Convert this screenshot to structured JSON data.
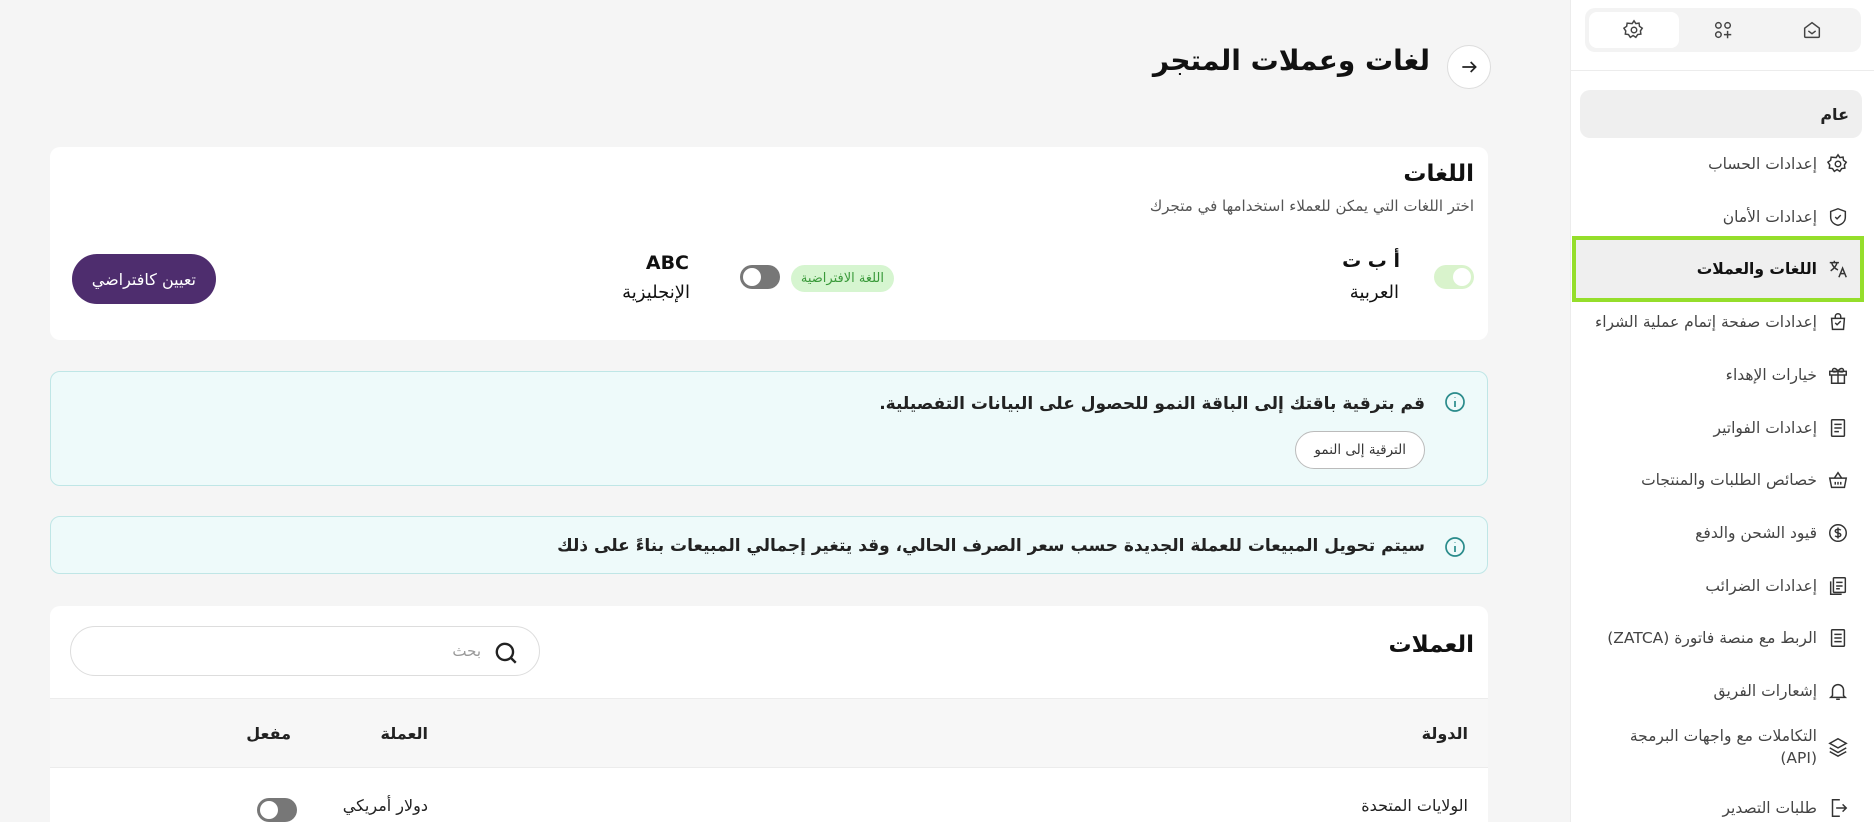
{
  "sidebar": {
    "tabs": [
      {
        "icon": "home-icon"
      },
      {
        "icon": "apps-plus-icon"
      },
      {
        "icon": "gear-icon"
      }
    ],
    "section_label": "عام",
    "items": [
      {
        "label": "إعدادات الحساب",
        "icon": "gear-icon"
      },
      {
        "label": "إعدادات الأمان",
        "icon": "shield-icon"
      },
      {
        "label": "اللغات والعملات",
        "icon": "translate-icon",
        "active": true
      },
      {
        "label": "إعدادات صفحة إتمام عملية الشراء",
        "icon": "shopping-bag-icon"
      },
      {
        "label": "خيارات الإهداء",
        "icon": "gift-icon"
      },
      {
        "label": "إعدادات الفواتير",
        "icon": "invoice-icon"
      },
      {
        "label": "خصائص الطلبات والمنتجات",
        "icon": "basket-icon"
      },
      {
        "label": "قيود الشحن والدفع",
        "icon": "dollar-coin-icon"
      },
      {
        "label": "إعدادات الضرائب",
        "icon": "tax-document-icon"
      },
      {
        "label": "الربط مع منصة فاتورة (ZATCA)",
        "icon": "receipt-icon"
      },
      {
        "label": "إشعارات الفريق",
        "icon": "bell-icon"
      },
      {
        "label": "التكاملات مع واجهات البرمجة (API)",
        "icon": "layers-icon"
      },
      {
        "label": "طلبات التصدير",
        "icon": "export-icon"
      }
    ]
  },
  "header": {
    "title": "لغات وعملات المتجر"
  },
  "languages": {
    "title": "اللغات",
    "subtitle": "اختر اللغات التي يمكن للعملاء استخدامها في متجرك",
    "arabic": {
      "glyph": "أ ب ت",
      "name": "العربية",
      "enabled": true
    },
    "default_badge": "اللغة الافتراضية",
    "english": {
      "glyph": "ABC",
      "name": "الإنجليزية",
      "enabled": false
    },
    "set_default_button": "تعيين كافتراضي"
  },
  "upgrade_notice": {
    "text": "قم بترقية باقتك إلى الباقة النمو للحصول على البيانات التفصيلية.",
    "button": "الترقية إلى النمو"
  },
  "conversion_notice": {
    "text": "سيتم تحويل المبيعات للعملة الجديدة حسب سعر الصرف الحالي، وقد يتغير إجمالي المبيعات بناءً على ذلك"
  },
  "currencies": {
    "title": "العملات",
    "search_placeholder": "بحث",
    "columns": {
      "country": "الدولة",
      "currency": "العملة",
      "enabled": "مفعل"
    },
    "rows": [
      {
        "country": "الولايات المتحدة",
        "currency": "دولار أمريكي",
        "enabled": false
      }
    ]
  }
}
